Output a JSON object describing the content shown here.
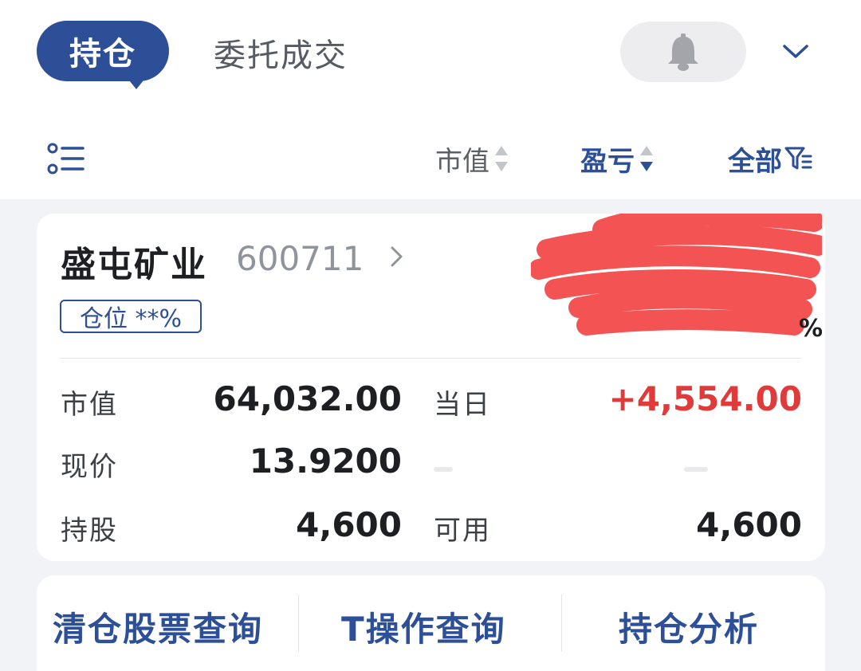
{
  "header": {
    "tab_holdings": "持仓",
    "tab_orders": "委托成交"
  },
  "toolbar": {
    "sort_market_value": "市值",
    "sort_profit_loss": "盈亏",
    "filter_all": "全部"
  },
  "position": {
    "name": "盛屯矿业",
    "code": "600711",
    "position_ratio": "仓位 **%",
    "rows": [
      {
        "left_label": "市值",
        "left_value": "64,032.00",
        "right_label": "当日",
        "right_value": "+4,554.00"
      },
      {
        "left_label": "现价",
        "left_value": "13.9200",
        "right_label": "",
        "right_value": ""
      },
      {
        "left_label": "持股",
        "left_value": "4,600",
        "right_label": "可用",
        "right_value": "4,600"
      }
    ]
  },
  "links": {
    "clear_query": "清仓股票查询",
    "t_query": "T操作查询",
    "analysis": "持仓分析"
  },
  "colors": {
    "brand": "#2c4f97",
    "gain": "#e03b3b",
    "background": "#f2f3f6"
  }
}
